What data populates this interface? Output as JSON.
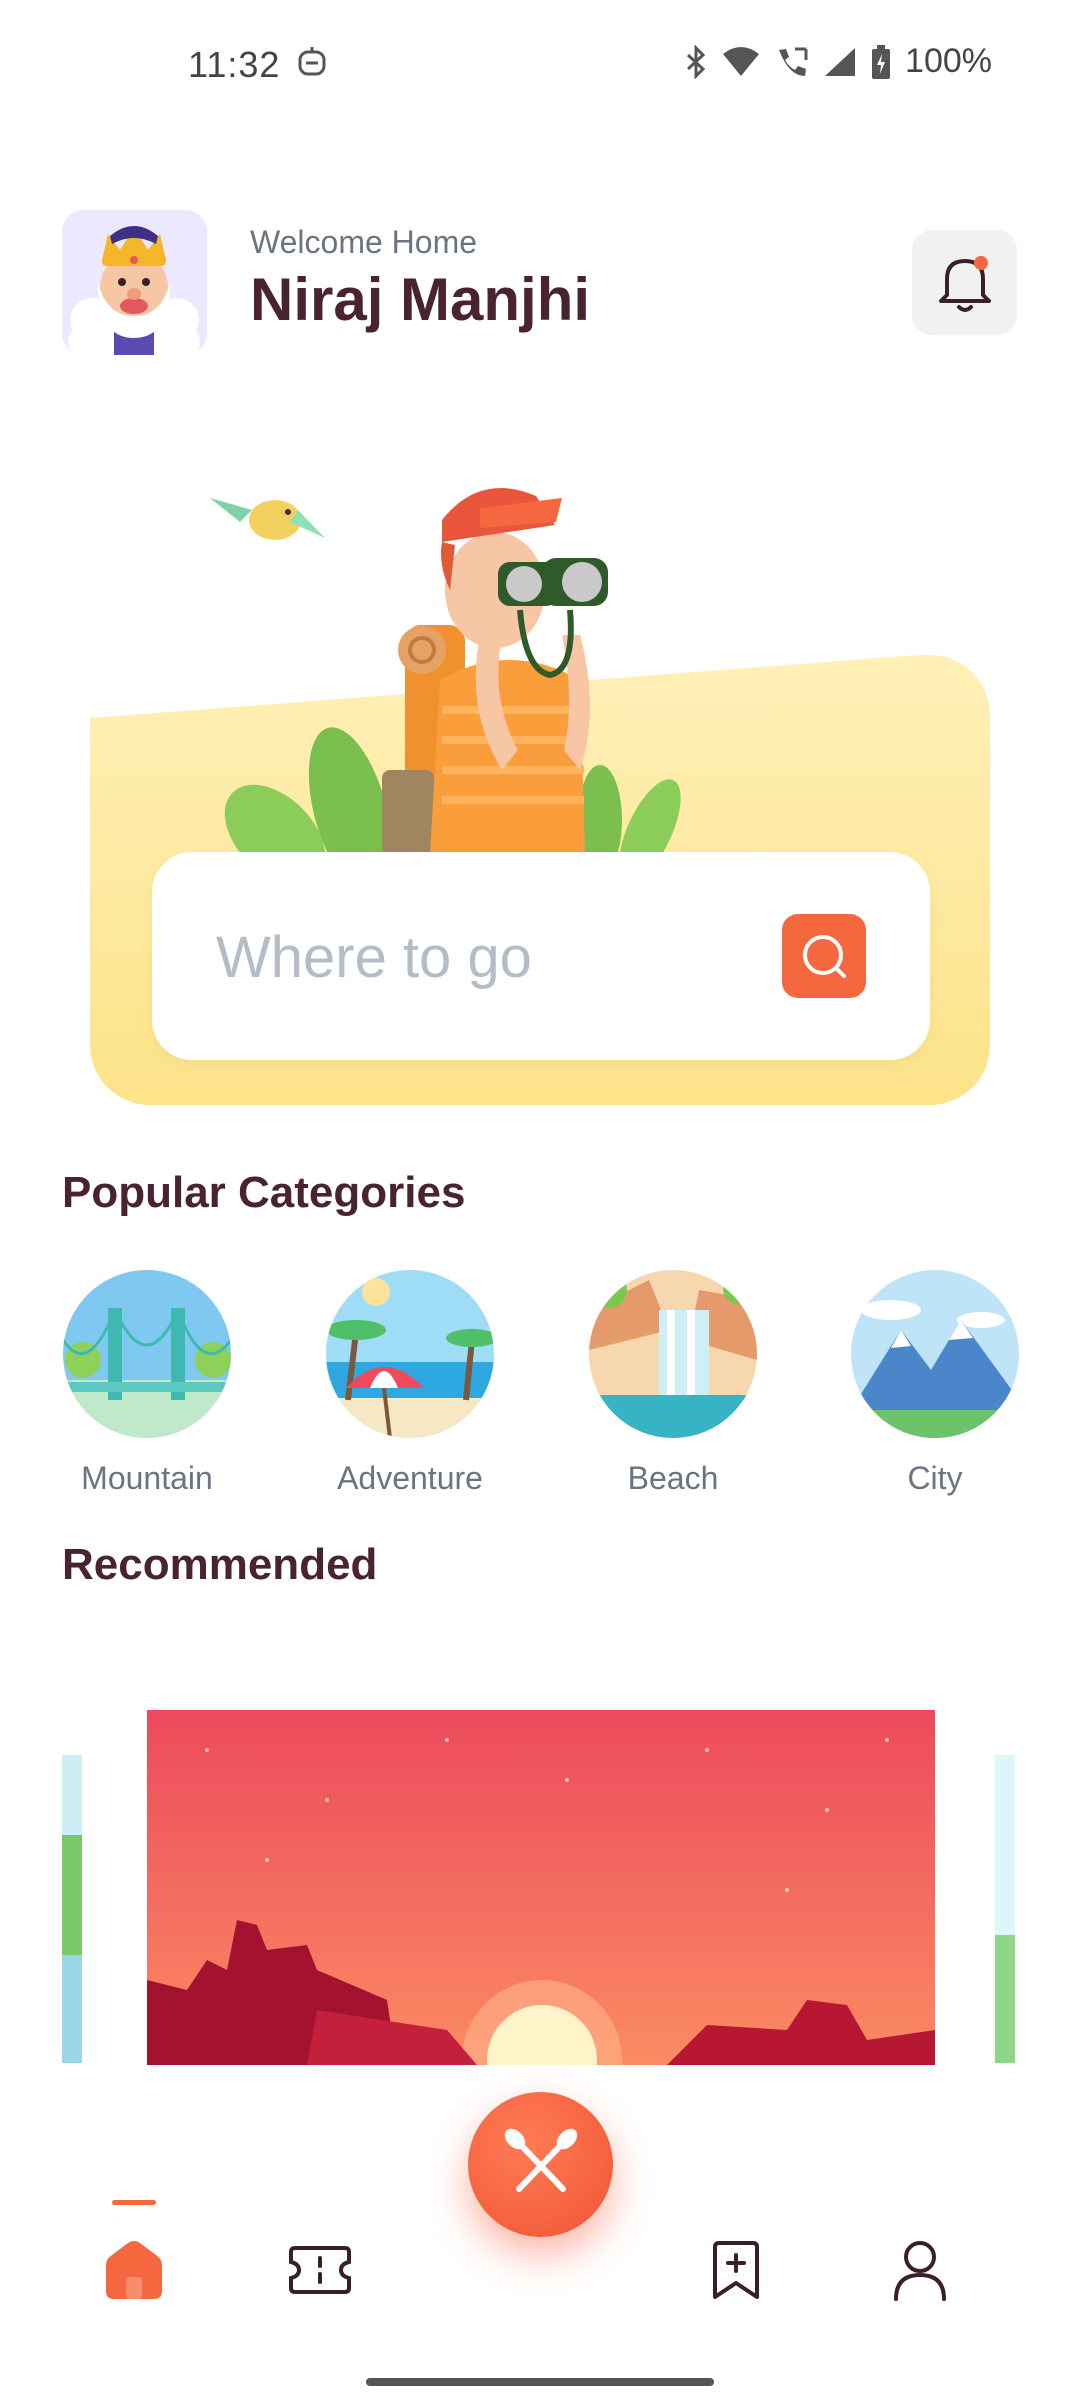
{
  "status_bar": {
    "time": "11:32",
    "battery": "100%",
    "icons": [
      "robot-icon",
      "bluetooth-icon",
      "wifi-icon",
      "call-icon",
      "signal-icon",
      "battery-icon"
    ]
  },
  "header": {
    "greeting": "Welcome Home",
    "user_name": "Niraj Manjhi",
    "notification_dot": true
  },
  "search": {
    "placeholder": "Where to go"
  },
  "sections": {
    "categories_title": "Popular Categories",
    "recommended_title": "Recommended"
  },
  "categories": [
    {
      "label": "Mountain",
      "icon": "bridge-illustration"
    },
    {
      "label": "Adventure",
      "icon": "beach-umbrella-illustration"
    },
    {
      "label": "Beach",
      "icon": "waterfall-illustration"
    },
    {
      "label": "City",
      "icon": "snow-mountain-illustration"
    }
  ],
  "bottom_nav": {
    "items": [
      "home-icon",
      "ticket-icon",
      "compass-fab-icon",
      "bookmark-add-icon",
      "profile-icon"
    ],
    "active": "home-icon"
  },
  "colors": {
    "accent": "#f5673f",
    "title": "#4a2330",
    "muted": "#6b7480",
    "hero_yellow": "#fde389"
  }
}
